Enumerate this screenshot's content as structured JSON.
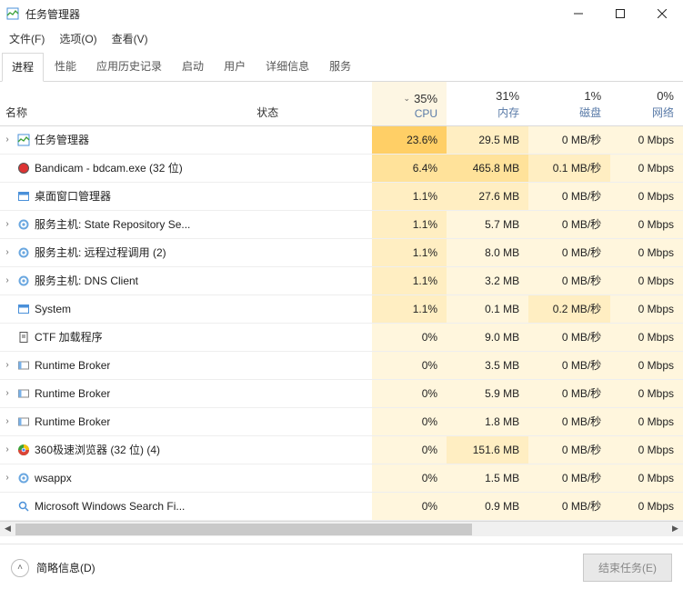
{
  "window": {
    "title": "任务管理器",
    "menu": {
      "file": "文件(F)",
      "options": "选项(O)",
      "view": "查看(V)"
    },
    "controls": {
      "min": "minimize",
      "max": "maximize",
      "close": "close"
    }
  },
  "tabs": {
    "processes": "进程",
    "performance": "性能",
    "app_history": "应用历史记录",
    "startup": "启动",
    "users": "用户",
    "details": "详细信息",
    "services": "服务"
  },
  "columns": {
    "name": "名称",
    "status": "状态",
    "cpu_pct": "35%",
    "cpu_label": "CPU",
    "mem_pct": "31%",
    "mem_label": "内存",
    "disk_pct": "1%",
    "disk_label": "磁盘",
    "net_pct": "0%",
    "net_label": "网络"
  },
  "footer": {
    "less_details": "简略信息(D)",
    "end_task": "结束任务(E)"
  },
  "rows": [
    {
      "expandable": true,
      "icon": "taskmgr",
      "name": "任务管理器",
      "cpu": "23.6%",
      "cpu_heat": 4,
      "mem": "29.5 MB",
      "mem_heat": 2,
      "disk": "0 MB/秒",
      "disk_heat": 1,
      "net": "0 Mbps",
      "net_heat": 1
    },
    {
      "expandable": false,
      "icon": "record",
      "name": "Bandicam - bdcam.exe (32 位)",
      "cpu": "6.4%",
      "cpu_heat": 3,
      "mem": "465.8 MB",
      "mem_heat": 3,
      "disk": "0.1 MB/秒",
      "disk_heat": 2,
      "net": "0 Mbps",
      "net_heat": 1
    },
    {
      "expandable": false,
      "icon": "window",
      "name": "桌面窗口管理器",
      "cpu": "1.1%",
      "cpu_heat": 2,
      "mem": "27.6 MB",
      "mem_heat": 2,
      "disk": "0 MB/秒",
      "disk_heat": 1,
      "net": "0 Mbps",
      "net_heat": 1
    },
    {
      "expandable": true,
      "icon": "gear",
      "name": "服务主机: State Repository Se...",
      "cpu": "1.1%",
      "cpu_heat": 2,
      "mem": "5.7 MB",
      "mem_heat": 1,
      "disk": "0 MB/秒",
      "disk_heat": 1,
      "net": "0 Mbps",
      "net_heat": 1
    },
    {
      "expandable": true,
      "icon": "gear",
      "name": "服务主机: 远程过程调用 (2)",
      "cpu": "1.1%",
      "cpu_heat": 2,
      "mem": "8.0 MB",
      "mem_heat": 1,
      "disk": "0 MB/秒",
      "disk_heat": 1,
      "net": "0 Mbps",
      "net_heat": 1
    },
    {
      "expandable": true,
      "icon": "gear",
      "name": "服务主机: DNS Client",
      "cpu": "1.1%",
      "cpu_heat": 2,
      "mem": "3.2 MB",
      "mem_heat": 1,
      "disk": "0 MB/秒",
      "disk_heat": 1,
      "net": "0 Mbps",
      "net_heat": 1
    },
    {
      "expandable": false,
      "icon": "window",
      "name": "System",
      "cpu": "1.1%",
      "cpu_heat": 2,
      "mem": "0.1 MB",
      "mem_heat": 1,
      "disk": "0.2 MB/秒",
      "disk_heat": 2,
      "net": "0 Mbps",
      "net_heat": 1
    },
    {
      "expandable": false,
      "icon": "file",
      "name": "CTF 加载程序",
      "cpu": "0%",
      "cpu_heat": 1,
      "mem": "9.0 MB",
      "mem_heat": 1,
      "disk": "0 MB/秒",
      "disk_heat": 1,
      "net": "0 Mbps",
      "net_heat": 1
    },
    {
      "expandable": true,
      "icon": "broker",
      "name": "Runtime Broker",
      "cpu": "0%",
      "cpu_heat": 1,
      "mem": "3.5 MB",
      "mem_heat": 1,
      "disk": "0 MB/秒",
      "disk_heat": 1,
      "net": "0 Mbps",
      "net_heat": 1
    },
    {
      "expandable": true,
      "icon": "broker",
      "name": "Runtime Broker",
      "cpu": "0%",
      "cpu_heat": 1,
      "mem": "5.9 MB",
      "mem_heat": 1,
      "disk": "0 MB/秒",
      "disk_heat": 1,
      "net": "0 Mbps",
      "net_heat": 1
    },
    {
      "expandable": true,
      "icon": "broker",
      "name": "Runtime Broker",
      "cpu": "0%",
      "cpu_heat": 1,
      "mem": "1.8 MB",
      "mem_heat": 1,
      "disk": "0 MB/秒",
      "disk_heat": 1,
      "net": "0 Mbps",
      "net_heat": 1
    },
    {
      "expandable": true,
      "icon": "chrome",
      "name": "360极速浏览器 (32 位) (4)",
      "cpu": "0%",
      "cpu_heat": 1,
      "mem": "151.6 MB",
      "mem_heat": 2,
      "disk": "0 MB/秒",
      "disk_heat": 1,
      "net": "0 Mbps",
      "net_heat": 1
    },
    {
      "expandable": true,
      "icon": "gear",
      "name": "wsappx",
      "cpu": "0%",
      "cpu_heat": 1,
      "mem": "1.5 MB",
      "mem_heat": 1,
      "disk": "0 MB/秒",
      "disk_heat": 1,
      "net": "0 Mbps",
      "net_heat": 1
    },
    {
      "expandable": false,
      "icon": "search",
      "name": "Microsoft Windows Search Fi...",
      "cpu": "0%",
      "cpu_heat": 1,
      "mem": "0.9 MB",
      "mem_heat": 1,
      "disk": "0 MB/秒",
      "disk_heat": 1,
      "net": "0 Mbps",
      "net_heat": 1
    }
  ],
  "icons": {
    "taskmgr": "taskmgr-icon",
    "record": "record-icon",
    "window": "window-icon",
    "gear": "gear-icon",
    "file": "file-icon",
    "broker": "broker-icon",
    "chrome": "chrome-icon",
    "search": "search-icon"
  }
}
